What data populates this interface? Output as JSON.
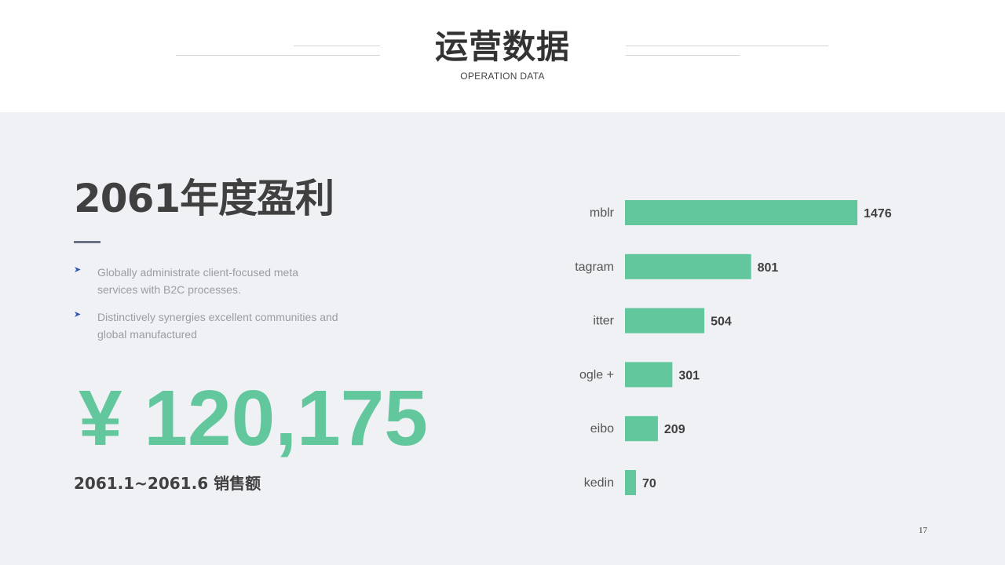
{
  "slide": {
    "title": "运营数据",
    "subtitle": "OPERATION DATA",
    "section_title": "2061年度盈利",
    "bullets": [
      {
        "icon": "arrow-bullet-icon",
        "text": "Globally administrate client-focused meta services with B2C processes."
      },
      {
        "icon": "arrow-bullet-icon",
        "text": "Distinctively synergies excellent communities and global manufactured"
      }
    ],
    "big_number": "¥ 120,175",
    "period_label": "2061.1~2061.6 销售额",
    "page_number": "17"
  },
  "colors": {
    "bar": "#62c79c",
    "accent_number": "#62c79c",
    "background": "#f0f1f5",
    "bullet_icon": "#2f55b8"
  },
  "chart_data": {
    "type": "bar",
    "orientation": "horizontal",
    "categories": [
      "mblr",
      "tagram",
      "itter",
      "ogle +",
      "eibo",
      "kedin"
    ],
    "values": [
      1476,
      801,
      504,
      301,
      209,
      70
    ],
    "data_labels": [
      "1476",
      "801",
      "504",
      "301",
      "209",
      "70"
    ],
    "xlim": [
      0,
      1476
    ],
    "grid": false,
    "legend": "none"
  }
}
